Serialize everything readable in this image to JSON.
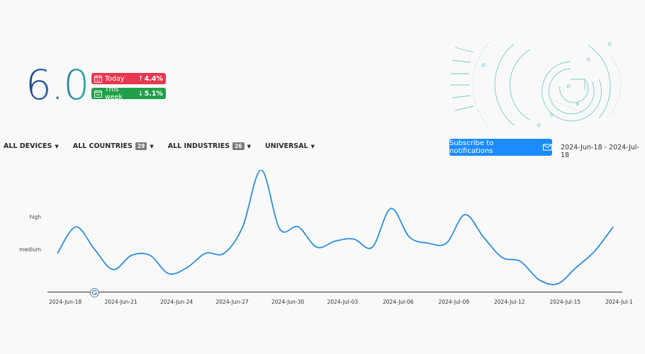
{
  "score": "6.0",
  "badges": [
    {
      "label": "Today",
      "direction": "up",
      "arrow": "↑",
      "change": "4.4%",
      "color": "#e8384f",
      "icon": "calendar-icon"
    },
    {
      "label": "This week",
      "direction": "down",
      "arrow": "↓",
      "change": "5.1%",
      "color": "#21a049",
      "icon": "calendar-icon"
    }
  ],
  "filters": [
    {
      "label": "ALL DEVICES",
      "count": null
    },
    {
      "label": "ALL COUNTRIES",
      "count": "29"
    },
    {
      "label": "ALL INDUSTRIES",
      "count": "26"
    },
    {
      "label": "UNIVERSAL",
      "count": null
    }
  ],
  "subscribe": {
    "label": "Subscribe to notifications",
    "icon": "mail-icon"
  },
  "date_range": "2024-Jun-18 - 2024-Jul-18",
  "chart_data": {
    "type": "line",
    "line_color": "#2b8ee0",
    "y_labels": [
      "high",
      "medium"
    ],
    "x_tick_labels": [
      "2024-Jun-18",
      "2024-Jun-21",
      "2024-Jun-24",
      "2024-Jun-27",
      "2024-Jun-30",
      "2024-Jul-03",
      "2024-Jul-06",
      "2024-Jul-09",
      "2024-Jul-12",
      "2024-Jul-15",
      "2024-Jul-1"
    ],
    "marker": {
      "date_index": 2,
      "icon": "google-g-icon"
    },
    "series": [
      {
        "values": [
          5.2,
          6.5,
          5.4,
          4.4,
          5.1,
          5.1,
          4.2,
          4.5,
          5.2,
          5.2,
          6.5,
          9.3,
          6.4,
          6.5,
          5.5,
          5.8,
          5.9,
          5.5,
          7.4,
          6.0,
          5.7,
          5.7,
          7.1,
          6.0,
          5.0,
          4.8,
          3.9,
          3.7,
          4.5,
          5.3,
          6.5
        ]
      }
    ],
    "y_scale": {
      "high": 7.0,
      "medium": 5.4
    }
  }
}
